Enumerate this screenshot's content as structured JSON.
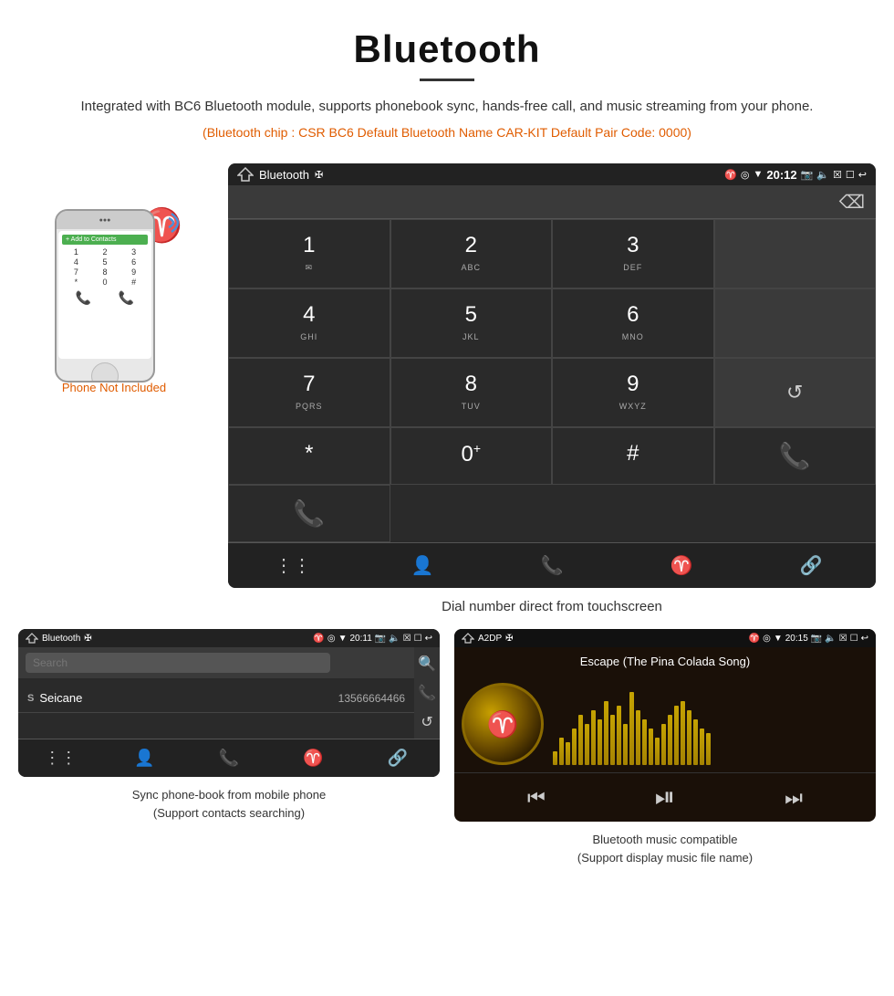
{
  "header": {
    "title": "Bluetooth",
    "description": "Integrated with BC6 Bluetooth module, supports phonebook sync, hands-free call, and music streaming from your phone.",
    "specs": "(Bluetooth chip : CSR BC6    Default Bluetooth Name CAR-KIT    Default Pair Code: 0000)"
  },
  "dialpad": {
    "statusbar": {
      "app_name": "Bluetooth",
      "time": "20:12"
    },
    "keys": [
      {
        "main": "1",
        "sub": ""
      },
      {
        "main": "2",
        "sub": "ABC"
      },
      {
        "main": "3",
        "sub": "DEF"
      },
      {
        "main": "4",
        "sub": "GHI"
      },
      {
        "main": "5",
        "sub": "JKL"
      },
      {
        "main": "6",
        "sub": "MNO"
      },
      {
        "main": "7",
        "sub": "PQRS"
      },
      {
        "main": "8",
        "sub": "TUV"
      },
      {
        "main": "9",
        "sub": "WXYZ"
      },
      {
        "main": "*",
        "sub": ""
      },
      {
        "main": "0",
        "sub": "+"
      },
      {
        "main": "#",
        "sub": ""
      }
    ],
    "caption": "Dial number direct from touchscreen"
  },
  "phone_section": {
    "not_included_label": "Phone Not Included"
  },
  "phonebook": {
    "statusbar_app": "Bluetooth",
    "statusbar_time": "20:11",
    "search_placeholder": "Search",
    "contacts": [
      {
        "letter": "S",
        "name": "Seicane",
        "number": "13566664466"
      }
    ],
    "caption_line1": "Sync phone-book from mobile phone",
    "caption_line2": "(Support contacts searching)"
  },
  "music": {
    "statusbar_app": "A2DP",
    "statusbar_time": "20:15",
    "song_title": "Escape (The Pina Colada Song)",
    "caption_line1": "Bluetooth music compatible",
    "caption_line2": "(Support display music file name)"
  },
  "visualizer_bars": [
    15,
    30,
    25,
    40,
    55,
    45,
    60,
    50,
    70,
    55,
    65,
    45,
    80,
    60,
    50,
    40,
    30,
    45,
    55,
    65,
    70,
    60,
    50,
    40,
    35
  ]
}
